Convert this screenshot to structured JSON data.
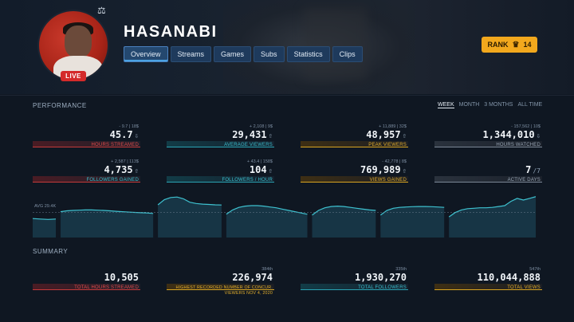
{
  "profile": {
    "username": "HASANABI",
    "live_badge": "LIVE",
    "rank_label": "RANK",
    "rank_value": "14",
    "icons": {
      "crown": "crown-icon",
      "scale": "scale-icon"
    }
  },
  "tabs": [
    {
      "label": "Overview",
      "active": true
    },
    {
      "label": "Streams"
    },
    {
      "label": "Games"
    },
    {
      "label": "Subs"
    },
    {
      "label": "Statistics"
    },
    {
      "label": "Clips"
    }
  ],
  "performance": {
    "title": "PERFORMANCE",
    "ranges": [
      "WEEK",
      "MONTH",
      "3 MONTHS",
      "ALL TIME"
    ],
    "active_range": "WEEK",
    "stats": [
      {
        "sub": "- 9.7 | 18$",
        "value": "45.7",
        "label": "HOURS STREAMED",
        "color": "red"
      },
      {
        "sub": "+ 2,108 | 9$",
        "value": "29,431",
        "label": "AVERAGE VIEWERS",
        "color": "teal"
      },
      {
        "sub": "+ 11,889 | 32$",
        "value": "48,957",
        "label": "PEAK VIEWERS",
        "color": "gold"
      },
      {
        "sub": "- 157,562 | 10$",
        "value": "1,344,010",
        "label": "HOURS WATCHED",
        "color": "grey"
      },
      {
        "sub": "+ 2,587 | 113$",
        "value": "4,735",
        "label": "FOLLOWERS GAINED",
        "color": "red"
      },
      {
        "sub": "+ 43.4 | 158$",
        "value": "104",
        "label": "FOLLOWERS / HOUR",
        "color": "teal"
      },
      {
        "sub": "- 42,778 | 8$",
        "value": "769,989",
        "label": "VIEWS GAINED",
        "color": "gold"
      },
      {
        "sub": "",
        "value": "7",
        "value_suffix": "/7",
        "label": "ACTIVE DAYS",
        "color": "grey"
      }
    ],
    "chart_avg_label": "AVG 29.4K"
  },
  "summary": {
    "title": "SUMMARY",
    "stats": [
      {
        "sub": "",
        "value": "10,505",
        "label": "TOTAL HOURS STREAMED",
        "color": "red"
      },
      {
        "sub": "384th",
        "value": "226,974",
        "label": "HIGHEST RECORDED NUMBER OF CONCUR. VIEWERS NOV 4, 2020",
        "color": "gold"
      },
      {
        "sub": "335th",
        "value": "1,930,270",
        "label": "TOTAL FOLLOWERS",
        "color": "teal"
      },
      {
        "sub": "547th",
        "value": "110,044,888",
        "label": "TOTAL VIEWS",
        "color": "gold"
      }
    ]
  },
  "chart_data": {
    "type": "area",
    "title": "",
    "xlabel": "",
    "ylabel": "",
    "avg_line": 29400,
    "ylim": [
      0,
      50000
    ],
    "series": [
      {
        "values": [
          22000,
          21500,
          21000,
          21500
        ]
      },
      {
        "values": [
          30000,
          31000,
          31500,
          31800,
          32000,
          32000,
          31800,
          31500,
          31000,
          30500,
          30000,
          29500,
          29200,
          28800,
          28500,
          28000
        ]
      },
      {
        "values": [
          38000,
          44000,
          46500,
          47000,
          45000,
          41000,
          39500,
          38800,
          38400,
          38000,
          37800
        ]
      },
      {
        "values": [
          27000,
          32000,
          35000,
          36500,
          37000,
          37000,
          36500,
          35500,
          34500,
          33000,
          31500,
          30000,
          28500,
          27000
        ]
      },
      {
        "values": [
          26000,
          31500,
          34500,
          36000,
          36500,
          36000,
          35000,
          34000,
          33000,
          32000,
          31500
        ]
      },
      {
        "values": [
          26000,
          31500,
          34000,
          35000,
          35500,
          35800,
          36000,
          36000,
          35800,
          35500,
          35000
        ]
      },
      {
        "values": [
          24000,
          29000,
          32000,
          33500,
          34000,
          34500,
          34500,
          35000,
          36000,
          37000,
          42000,
          45500,
          43500,
          45500,
          47500
        ]
      }
    ]
  }
}
